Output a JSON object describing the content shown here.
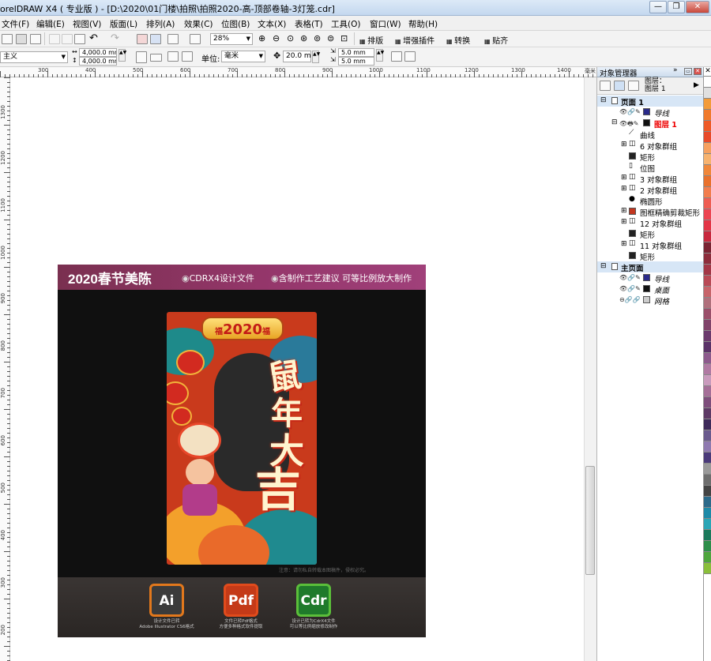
{
  "window": {
    "title": "orelDRAW X4 ( 专业版 ) - [D:\\2020\\01门楼\\拍照\\拍照2020-高-顶部卷轴-3灯笼.cdr]",
    "min": "—",
    "restore": "❐",
    "close": "✕"
  },
  "menu": [
    "文件(F)",
    "编辑(E)",
    "视图(V)",
    "版面(L)",
    "排列(A)",
    "效果(C)",
    "位图(B)",
    "文本(X)",
    "表格(T)",
    "工具(O)",
    "窗口(W)",
    "帮助(H)"
  ],
  "toolbar": {
    "zoom": "28%",
    "plugins": [
      "排版",
      "增强插件",
      "转换",
      "贴齐"
    ]
  },
  "propbar": {
    "paper": "主义",
    "width": "4,000.0 mm",
    "height": "4,000.0 mm",
    "unit_label": "单位:",
    "unit": "毫米",
    "nudge": "20.0 mm",
    "dup_x": "5.0 mm",
    "dup_y": "5.0 mm"
  },
  "ruler": {
    "h": [
      "300",
      "400",
      "500",
      "600",
      "700",
      "800",
      "900",
      "1000",
      "1100",
      "1200",
      "1300",
      "1400"
    ],
    "v": [
      "1300",
      "1200",
      "1100",
      "1000",
      "900",
      "800",
      "700",
      "600",
      "500",
      "400",
      "300",
      "200"
    ],
    "unit": "毫米"
  },
  "artwork": {
    "banner_title": "2020春节美陈",
    "chip1": "CDRX4设计文件",
    "chip2": "含制作工艺建议 可等比例放大制作",
    "year": "2020",
    "year_mark": "福",
    "slogan": [
      "鼠",
      "年",
      "大",
      "吉"
    ],
    "note": "注意：请勿私自转载本图稿件，侵权必究。",
    "formats": [
      {
        "label": "Ai",
        "color": "#e2781c",
        "bg": "#3b3b3b",
        "cap1": "设计文件已转",
        "cap2": "Adobe Illustrator CS6格式"
      },
      {
        "label": "Pdf",
        "color": "#e14b1c",
        "bg": "#c43a18",
        "cap1": "文件已转Pdf格式",
        "cap2": "方便多种格式软件提取"
      },
      {
        "label": "Cdr",
        "color": "#5bbf3a",
        "bg": "#1f7a2b",
        "cap1": "设计已转为CdrX4文件",
        "cap2": "可以等比例缩放修改制作"
      }
    ]
  },
  "panel": {
    "title": "对象管理器",
    "layer_hd": [
      "图层：",
      "图层 1"
    ],
    "tree": [
      {
        "t": "页面 1",
        "lvl": 0,
        "exp": "⊟",
        "page": true
      },
      {
        "t": "导线",
        "lvl": 1,
        "it": true,
        "sw": "#2a2a8a",
        "ey": "👁🔗✎"
      },
      {
        "t": "图层 1",
        "lvl": 1,
        "red": true,
        "exp": "⊟",
        "sw": "#111",
        "ey": "👁🖶✎"
      },
      {
        "t": "曲线",
        "lvl": 2,
        "ic": "⟋"
      },
      {
        "t": "6 对象群组",
        "lvl": 2,
        "exp": "⊞",
        "ic": "◫"
      },
      {
        "t": "矩形",
        "lvl": 2,
        "sw": "#222"
      },
      {
        "t": "位图",
        "lvl": 2,
        "ic": "▯"
      },
      {
        "t": "3 对象群组",
        "lvl": 2,
        "exp": "⊞",
        "ic": "◫"
      },
      {
        "t": "2 对象群组",
        "lvl": 2,
        "exp": "⊞",
        "ic": "◫"
      },
      {
        "t": "椭圆形",
        "lvl": 2,
        "ic": "●"
      },
      {
        "t": "图框精确剪裁矩形",
        "lvl": 2,
        "exp": "⊞",
        "sw": "#c2361f"
      },
      {
        "t": "12 对象群组",
        "lvl": 2,
        "exp": "⊞",
        "ic": "◫"
      },
      {
        "t": "矩形",
        "lvl": 2,
        "sw": "#222"
      },
      {
        "t": "11 对象群组",
        "lvl": 2,
        "exp": "⊞",
        "ic": "◫"
      },
      {
        "t": "矩形",
        "lvl": 2,
        "sw": "#222"
      },
      {
        "t": "主页面",
        "lvl": 0,
        "exp": "⊟",
        "page": true
      },
      {
        "t": "导线",
        "lvl": 1,
        "it": true,
        "sw": "#2a2a8a",
        "ey": "👁🔗✎"
      },
      {
        "t": "桌面",
        "lvl": 1,
        "it": true,
        "sw": "#111",
        "ey": "👁🔗✎"
      },
      {
        "t": "网格",
        "lvl": 1,
        "it": true,
        "sw": "#ccc",
        "ey": "⊖🔗🔗"
      }
    ]
  },
  "palette": [
    "#ffffff",
    "#e0e0e0",
    "#f29b3a",
    "#f07a2c",
    "#ee5a27",
    "#e84a2a",
    "#f6a160",
    "#f7b36f",
    "#f0873a",
    "#e9712c",
    "#f27d4d",
    "#ee5d53",
    "#ec4552",
    "#e33546",
    "#c8283e",
    "#7a2433",
    "#8d2d3c",
    "#a33747",
    "#b94a56",
    "#c7646a",
    "#b0707c",
    "#9a4f6a",
    "#80436a",
    "#6b3a6d",
    "#5a3268",
    "#8d5a8d",
    "#b07aa3",
    "#c99bbd",
    "#a56f98",
    "#7e4e7c",
    "#5e3a66",
    "#3e2a5a",
    "#6a5a8e",
    "#8f7ab0",
    "#4a3a7a",
    "#9a9a9a",
    "#6e6e6e",
    "#444444",
    "#2c6a8a",
    "#1e8aa8",
    "#2ba6b6",
    "#1b7a5c",
    "#2d8e4a",
    "#4ea63d",
    "#8abf3b"
  ]
}
